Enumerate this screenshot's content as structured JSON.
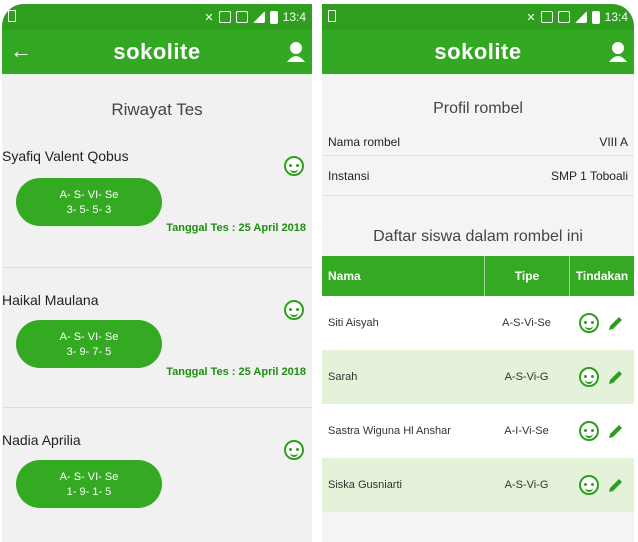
{
  "status": {
    "time": "13:4"
  },
  "left": {
    "app_title": "sokolite",
    "heading": "Riwayat Tes",
    "tests": [
      {
        "name": "Syafiq Valent Qobus",
        "code": "A- S- VI- Se",
        "scores": "3- 5- 5- 3",
        "date": "Tanggal Tes : 25 April 2018"
      },
      {
        "name": "Haikal Maulana",
        "code": "A- S- VI- Se",
        "scores": "3- 9- 7- 5",
        "date": "Tanggal Tes : 25 April 2018"
      },
      {
        "name": "Nadia Aprilia",
        "code": "A- S- VI- Se",
        "scores": "1- 9- 1- 5",
        "date": ""
      }
    ]
  },
  "right": {
    "status_time": "13:4",
    "app_title": "sokolite",
    "profile_heading": "Profil rombel",
    "fields": [
      {
        "label": "Nama rombel",
        "value": "VIII A"
      },
      {
        "label": "Instansi",
        "value": "SMP 1 Toboali"
      }
    ],
    "students_heading": "Daftar siswa dalam rombel ini",
    "table": {
      "headers": {
        "name": "Nama",
        "type": "Tipe",
        "action": "Tindakan"
      },
      "rows": [
        {
          "name": "Siti Aisyah",
          "type": "A-S-Vi-Se"
        },
        {
          "name": "Sarah",
          "type": "A-S-Vi-G"
        },
        {
          "name": "Sastra Wiguna Hl Anshar",
          "type": "A-I-Vi-Se"
        },
        {
          "name": "Siska Gusniarti",
          "type": "A-S-Vi-G"
        }
      ]
    }
  },
  "colors": {
    "primary": "#33a823",
    "status": "#2f9e1f",
    "alt_row": "#e3f2d9",
    "date_text": "#1d8f12"
  }
}
